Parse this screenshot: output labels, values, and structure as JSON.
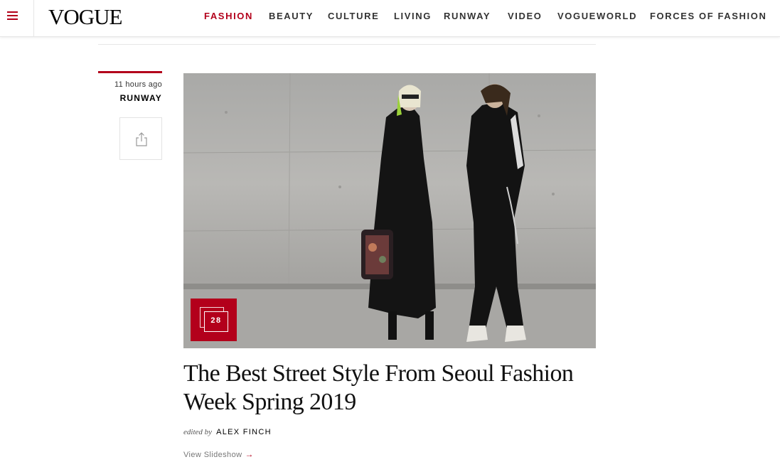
{
  "header": {
    "logo": "VOGUE",
    "nav": [
      {
        "label": "FASHION",
        "active": true
      },
      {
        "label": "BEAUTY",
        "active": false
      },
      {
        "label": "CULTURE",
        "active": false
      },
      {
        "label": "LIVING",
        "active": false
      },
      {
        "label": "RUNWAY",
        "active": false
      },
      {
        "label": "VIDEO",
        "active": false
      },
      {
        "label": "VOGUEWORLD",
        "active": false
      },
      {
        "label": "FORCES OF FASHION",
        "active": false
      }
    ]
  },
  "article": {
    "time_ago": "11 hours ago",
    "channel": "RUNWAY",
    "slide_count": "28",
    "headline": "The Best Street Style From Seoul Fashion Week Spring 2019",
    "edited_by_label": "edited by",
    "author": "ALEX FINCH",
    "cta_label": "View Slideshow",
    "cta_icon": "arrow-right-icon"
  },
  "icons": {
    "menu": "hamburger-menu-icon",
    "share": "share-icon",
    "gallery": "gallery-icon"
  },
  "colors": {
    "accent": "#b3001b",
    "text": "#000000",
    "muted": "#777777"
  }
}
